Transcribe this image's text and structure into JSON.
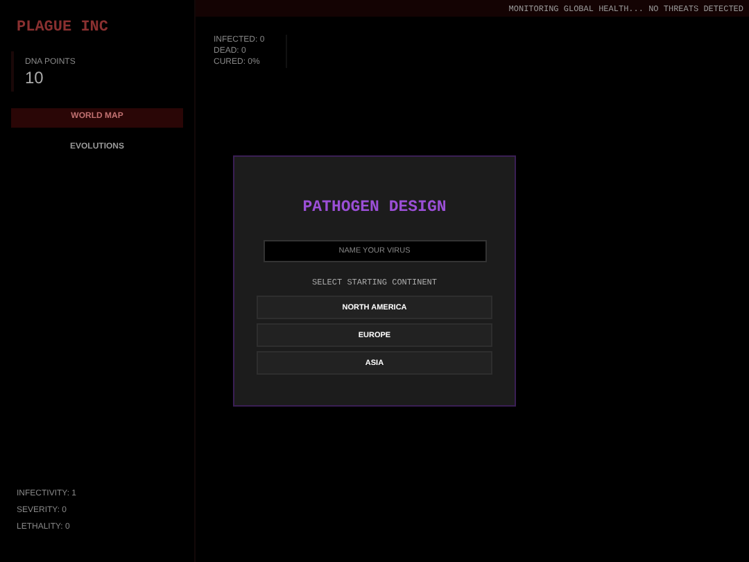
{
  "sidebar": {
    "title": "PLAGUE INC",
    "points": {
      "label": "DNA POINTS",
      "value": "10"
    },
    "nav": [
      {
        "label": "WORLD MAP",
        "selected": true
      },
      {
        "label": "EVOLUTIONS",
        "selected": false
      }
    ],
    "traits": [
      "INFECTIVITY: 1",
      "SEVERITY: 0",
      "LETHALITY: 0"
    ]
  },
  "status_bar": {
    "text": "MONITORING GLOBAL HEALTH... NO THREATS DETECTED"
  },
  "stats": [
    "INFECTED: 0",
    "DEAD: 0",
    "CURED: 0%"
  ],
  "dialog": {
    "title": "PATHOGEN DESIGN",
    "name_field": {
      "placeholder": "NAME YOUR VIRUS"
    },
    "prompt": "SELECT STARTING CONTINENT",
    "continents": [
      "NORTH AMERICA",
      "EUROPE",
      "ASIA"
    ]
  }
}
